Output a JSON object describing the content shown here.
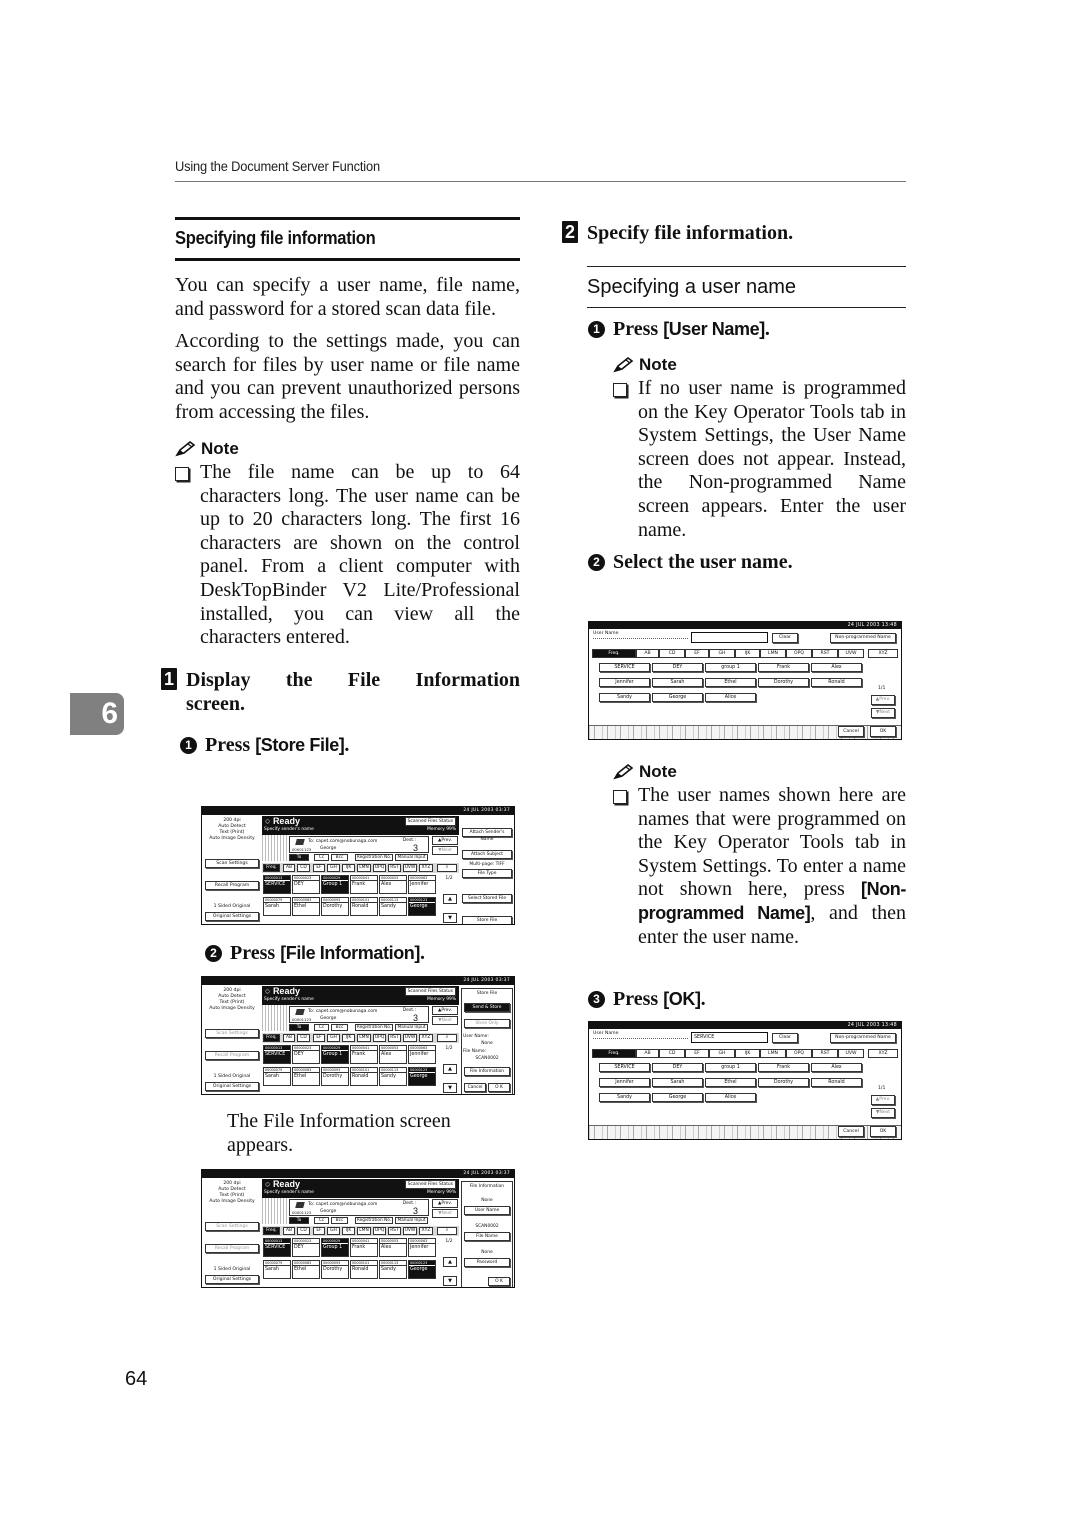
{
  "running_header": "Using the Document Server Function",
  "chapter_tab": "6",
  "page_number": "64",
  "left": {
    "section_title": "Specifying file information",
    "intro_paragraphs": [
      "You can specify a user name, file name, and password for a stored scan data file.",
      "According to the settings made, you can search for files by user name or file name and you can prevent unauthorized persons from accessing the files."
    ],
    "note_label": "Note",
    "note_text": "The file name can be up to 64 characters long. The user name can be up to 20 characters long. The first 16 characters are shown on the control panel. From a client computer with DeskTopBinder V2 Lite/Professional installed, you can view all the characters entered.",
    "step1": {
      "number": "1",
      "text": "Display the File Information screen.",
      "sub1": {
        "number": "1",
        "prefix": "Press ",
        "key": "[Store File]",
        "suffix": "."
      },
      "sub2": {
        "number": "2",
        "prefix": "Press ",
        "key": "[File Information]",
        "suffix": "."
      },
      "result": "The File Information screen appears."
    }
  },
  "right": {
    "step2": {
      "number": "2",
      "text": "Specify file information."
    },
    "subsection_title": "Specifying a user name",
    "sub1": {
      "number": "1",
      "prefix": "Press ",
      "key": "[User Name]",
      "suffix": "."
    },
    "note1_label": "Note",
    "note1_text": "If no user name is programmed on the Key Operator Tools tab in System Settings, the User Name screen does not appear. Instead, the Non-programmed Name screen appears. Enter the user name.",
    "sub2": {
      "number": "2",
      "text": "Select the user name."
    },
    "note2_label": "Note",
    "note2_text_before": "The user names shown here are names that were programmed on the Key Operator Tools tab in System Settings. To enter a name not shown here, press ",
    "note2_key": "[Non-programmed Name]",
    "note2_text_after": ", and then enter the user name.",
    "sub3": {
      "number": "3",
      "prefix": "Press ",
      "key": "[OK]",
      "suffix": "."
    }
  },
  "scanner_panel": {
    "left_info": [
      "200 dpi",
      "Auto Detect",
      "Text (Print)",
      "Auto Image Density"
    ],
    "scan_settings": "Scan Settings",
    "recall_program": "Recall Program",
    "sided_original": "1 Sided Original",
    "original_settings": "Original Settings",
    "ready": "Ready",
    "specify_sender": "Specify sender's name",
    "scanned_files_status": "Scanned Files Status",
    "memory": "Memory 99%",
    "to_label": "To:",
    "to_address": "capet.com@nobunaga.com",
    "sender_name": "George",
    "sender_code": "00001123",
    "dest_label": "Dest.:",
    "dest_count": "3",
    "prev": "▲Prev.",
    "next": "▼Next",
    "to_btn": "To",
    "cc_btn": "Cc",
    "bcc_btn": "Bcc",
    "registration_no": "Registration No.",
    "manual_input": "Manual Input",
    "tabs": [
      "Freq.",
      "AB",
      "CD",
      "EF",
      "GH",
      "IJK",
      "LMN",
      "OPQ",
      "RST",
      "UVW",
      "XYZ"
    ],
    "search_icon": "search-icon",
    "destinations": [
      {
        "id": "00000013",
        "name": "SERVICE",
        "selected": true
      },
      {
        "id": "00000023",
        "name": "DEY",
        "selected": false
      },
      {
        "id": "00000029",
        "name": "Group 1",
        "selected": true
      },
      {
        "id": "00000041",
        "name": "Frank",
        "selected": false
      },
      {
        "id": "00000053",
        "name": "Alex",
        "selected": false
      },
      {
        "id": "00000063",
        "name": "Jennifer",
        "selected": false
      },
      {
        "id": "00000079",
        "name": "Sarah",
        "selected": false
      },
      {
        "id": "00000083",
        "name": "Ethel",
        "selected": false
      },
      {
        "id": "00000093",
        "name": "Dorothy",
        "selected": false
      },
      {
        "id": "00000101",
        "name": "Ronald",
        "selected": false
      },
      {
        "id": "00000113",
        "name": "Sandy",
        "selected": false
      },
      {
        "id": "00000123",
        "name": "George",
        "selected": true
      }
    ],
    "page": "1/2",
    "datetime": "24 JUL 2003 03:37"
  },
  "screen1_right": {
    "attach_senders_name": "Attach Sender's Name",
    "attach_subject": "Attach Subject",
    "multi_page": "Multi-page: TIFF",
    "file_type": "File Type",
    "select_stored_file": "Select Stored File",
    "store_file": "Store File"
  },
  "screen2_right": {
    "title": "Store File",
    "send_store": "Send & Store",
    "store_only": "Store Only",
    "user_name_label": "User Name:",
    "user_name_value": "None",
    "file_name_label": "File Name:",
    "file_name_value": "SCAN0002",
    "file_information": "File Information",
    "cancel": "Cancel",
    "ok": "O K"
  },
  "screen3_right": {
    "title": "File Information",
    "user_name_value": "None",
    "user_name_btn": "User Name",
    "file_name_value": "SCAN0002",
    "file_name_btn": "File Name",
    "password_value": "None",
    "password_btn": "Password",
    "ok": "O K"
  },
  "user_name_panel": {
    "datetime": "24 JUL 2003 13:48",
    "label": "User Name",
    "clear": "Clear",
    "non_programmed_name": "Non-programmed Name",
    "tabs": [
      "Freq.",
      "AB",
      "CD",
      "EF",
      "GH",
      "IJK",
      "LMN",
      "OPQ",
      "RST",
      "UVW",
      "XYZ"
    ],
    "names": [
      "SERVICE",
      "DEY",
      "group 1",
      "Frank",
      "Alex",
      "Jennifer",
      "Sarah",
      "Ethel",
      "Dorothy",
      "Ronald",
      "Sandy",
      "George",
      "Alice"
    ],
    "page": "1/1",
    "prev": "▲Prev.",
    "next": "▼Next",
    "cancel": "Cancel",
    "ok": "OK",
    "input_value_before": "",
    "input_value_after": "SERVICE"
  }
}
